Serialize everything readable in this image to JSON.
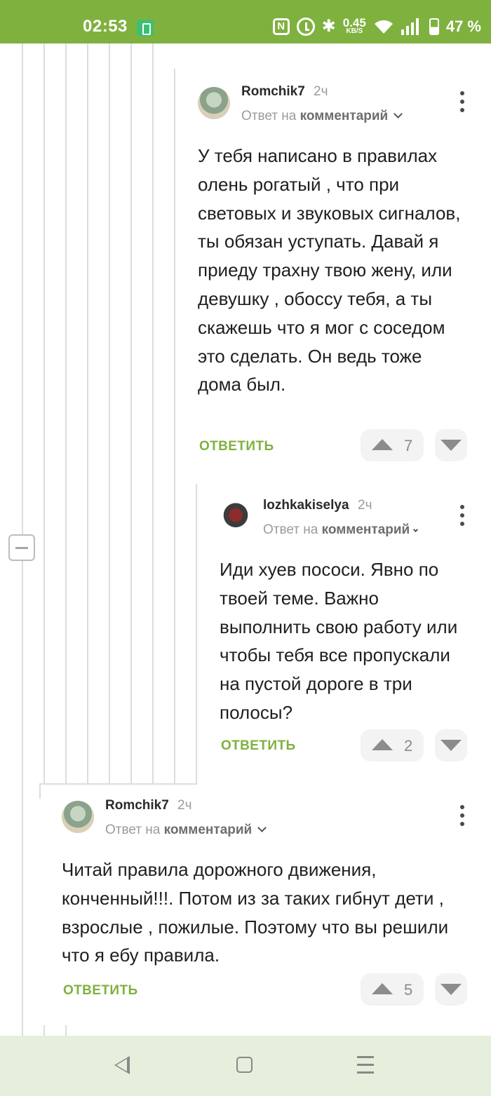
{
  "status_bar": {
    "time": "02:53",
    "nfc": "N",
    "bluetooth": "✱",
    "net_speed": "0.45",
    "net_speed_unit": "KB/S",
    "battery": "47 %"
  },
  "comments": [
    {
      "username": "Romchik7",
      "age": "2ч",
      "reply_prefix": "Ответ на",
      "reply_target": "комментарий",
      "body": "У тебя написано в правилах олень рогатый , что при световых и звуковых сигналов, ты обязан уступать. Давай я приеду трахну твою жену, или девушку , обоссу тебя, а ты скажешь что я мог с соседом это сделать. Он ведь тоже дома был.",
      "reply_label": "ОТВЕТИТЬ",
      "votes": "7"
    },
    {
      "username": "lozhkakiselya",
      "age": "2ч",
      "reply_prefix": "Ответ на",
      "reply_target": "комментарий",
      "body": "Иди хуев пососи. Явно по твоей теме. Важно выполнить свою работу или чтобы тебя все пропускали на пустой дороге в три полосы?",
      "reply_label": "ОТВЕТИТЬ",
      "votes": "2"
    },
    {
      "username": "Romchik7",
      "age": "2ч",
      "reply_prefix": "Ответ на",
      "reply_target": "комментарий",
      "body": "Читай правила дорожного движения, конченный!!!. Потом из за таких гибнут дети , взрослые , пожилые. Поэтому что вы решили что я ебу правила.",
      "reply_label": "ОТВЕТИТЬ",
      "votes": "5"
    }
  ],
  "colors": {
    "accent": "#7fb13f",
    "status_bar": "#7fb13f",
    "nav_bar": "#e6efdb",
    "thread_line": "#dddddd"
  },
  "icons": {
    "collapse": "minus-square-icon",
    "upvote": "triangle-up-icon",
    "downvote": "triangle-down-icon",
    "more": "kebab-icon",
    "nav_back": "triangle-back-icon",
    "nav_home": "square-home-icon",
    "nav_menu": "three-lines-menu-icon"
  }
}
